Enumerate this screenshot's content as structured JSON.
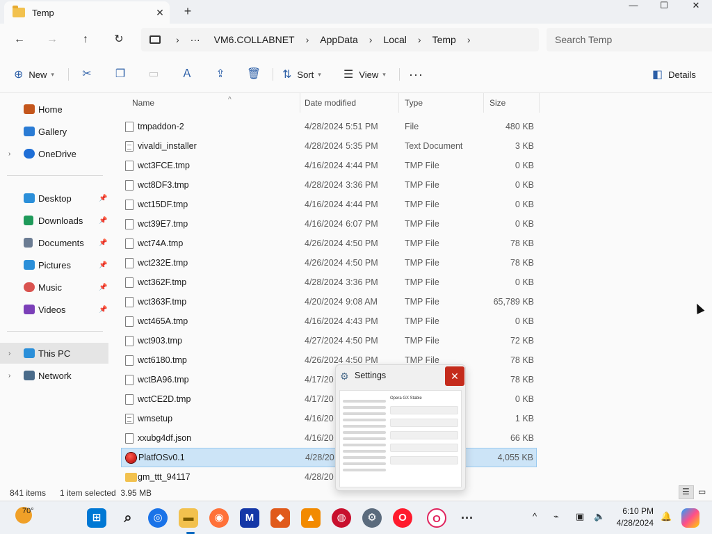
{
  "window": {
    "tab_title": "Temp",
    "new_tab_symbol": "+",
    "tab_close_symbol": "✕",
    "minimize_symbol": "—",
    "maximize_symbol": "☐",
    "close_symbol": "✕"
  },
  "address": {
    "overflow": "···",
    "breadcrumbs": [
      "VM6.COLLABNET",
      "AppData",
      "Local",
      "Temp"
    ],
    "search_placeholder": "Search Temp"
  },
  "commandbar": {
    "new_label": "New",
    "sort_label": "Sort",
    "view_label": "View",
    "more_symbol": "···",
    "details_label": "Details"
  },
  "sidebar": {
    "items": [
      {
        "label": "Home",
        "color": "#c4561c"
      },
      {
        "label": "Gallery",
        "color": "#2a7bd4"
      },
      {
        "label": "OneDrive",
        "color": "#1f6fd6"
      },
      {
        "label": "Desktop",
        "color": "#2b8fd9"
      },
      {
        "label": "Downloads",
        "color": "#1f9a5a"
      },
      {
        "label": "Documents",
        "color": "#6b7c93"
      },
      {
        "label": "Pictures",
        "color": "#2b8fd9"
      },
      {
        "label": "Music",
        "color": "#d9534f"
      },
      {
        "label": "Videos",
        "color": "#7b3fb8"
      },
      {
        "label": "This PC",
        "color": "#2b8fd9"
      },
      {
        "label": "Network",
        "color": "#4a6b8a"
      }
    ]
  },
  "columns": {
    "name": "Name",
    "date": "Date modified",
    "type": "Type",
    "size": "Size"
  },
  "files": [
    {
      "name": "tmpaddon-2",
      "date": "4/28/2024 5:51 PM",
      "type": "File",
      "size": "480 KB",
      "icon": "file"
    },
    {
      "name": "vivaldi_installer",
      "date": "4/28/2024 5:35 PM",
      "type": "Text Document",
      "size": "3 KB",
      "icon": "doc"
    },
    {
      "name": "wct3FCE.tmp",
      "date": "4/16/2024 4:44 PM",
      "type": "TMP File",
      "size": "0 KB",
      "icon": "file"
    },
    {
      "name": "wct8DF3.tmp",
      "date": "4/28/2024 3:36 PM",
      "type": "TMP File",
      "size": "0 KB",
      "icon": "file"
    },
    {
      "name": "wct15DF.tmp",
      "date": "4/16/2024 4:44 PM",
      "type": "TMP File",
      "size": "0 KB",
      "icon": "file"
    },
    {
      "name": "wct39E7.tmp",
      "date": "4/16/2024 6:07 PM",
      "type": "TMP File",
      "size": "0 KB",
      "icon": "file"
    },
    {
      "name": "wct74A.tmp",
      "date": "4/26/2024 4:50 PM",
      "type": "TMP File",
      "size": "78 KB",
      "icon": "file"
    },
    {
      "name": "wct232E.tmp",
      "date": "4/26/2024 4:50 PM",
      "type": "TMP File",
      "size": "78 KB",
      "icon": "file"
    },
    {
      "name": "wct362F.tmp",
      "date": "4/28/2024 3:36 PM",
      "type": "TMP File",
      "size": "0 KB",
      "icon": "file"
    },
    {
      "name": "wct363F.tmp",
      "date": "4/20/2024 9:08 AM",
      "type": "TMP File",
      "size": "65,789 KB",
      "icon": "file"
    },
    {
      "name": "wct465A.tmp",
      "date": "4/16/2024 4:43 PM",
      "type": "TMP File",
      "size": "0 KB",
      "icon": "file"
    },
    {
      "name": "wct903.tmp",
      "date": "4/27/2024 4:50 PM",
      "type": "TMP File",
      "size": "72 KB",
      "icon": "file"
    },
    {
      "name": "wct6180.tmp",
      "date": "4/26/2024 4:50 PM",
      "type": "TMP File",
      "size": "78 KB",
      "icon": "file"
    },
    {
      "name": "wctBA96.tmp",
      "date": "4/17/20",
      "type": "",
      "size": "78 KB",
      "icon": "file"
    },
    {
      "name": "wctCE2D.tmp",
      "date": "4/17/20",
      "type": "",
      "size": "0 KB",
      "icon": "file"
    },
    {
      "name": "wmsetup",
      "date": "4/16/20",
      "type": "",
      "size": "1 KB",
      "icon": "doc"
    },
    {
      "name": "xxubg4df.json",
      "date": "4/16/20",
      "type": "",
      "size": "66 KB",
      "icon": "file"
    },
    {
      "name": "PlatfOSv0.1",
      "date": "4/28/20",
      "type": "",
      "size": "4,055 KB",
      "icon": "app",
      "selected": true
    },
    {
      "name": "gm_ttt_94117",
      "date": "4/28/20",
      "type": "",
      "size": "",
      "icon": "folder"
    }
  ],
  "status": {
    "item_count": "841 items",
    "selection": "1 item selected  3.95 MB"
  },
  "preview": {
    "title": "Settings",
    "inner_title": "Opera GX Stable",
    "close_symbol": "✕"
  },
  "taskbar": {
    "weather_temp": "70°",
    "time": "6:10 PM",
    "date": "4/28/2024",
    "overflow_symbol": "···",
    "tray_chevron": "^"
  }
}
